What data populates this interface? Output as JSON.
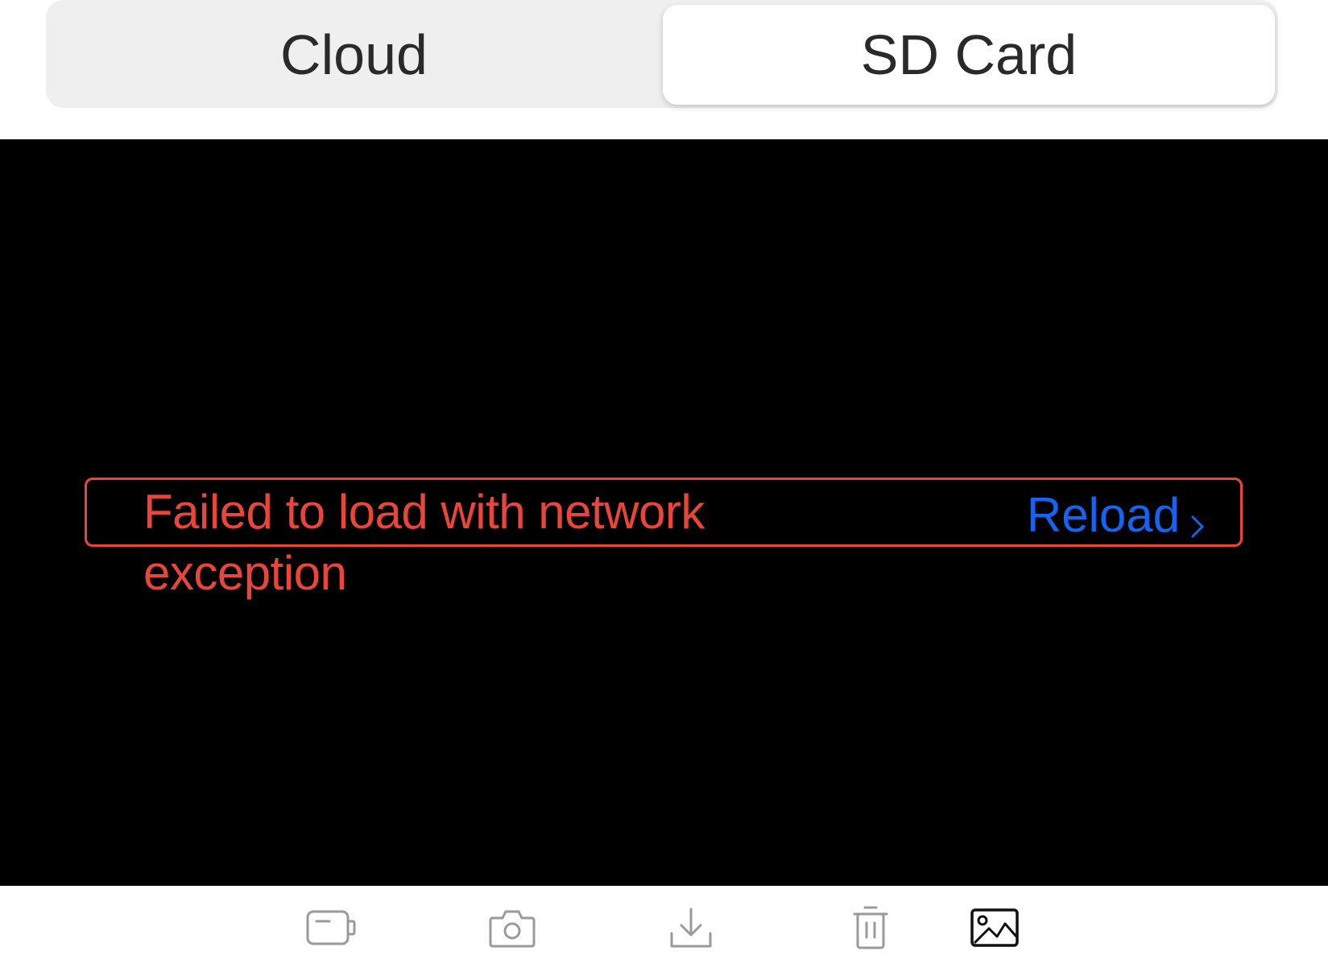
{
  "tabs": {
    "cloud_label": "Cloud",
    "sdcard_label": "SD Card",
    "selected": "SD Card"
  },
  "player": {
    "error_message": "Failed to load with network exception",
    "reload_label": "Reload"
  },
  "toolbar": {
    "icons": [
      "record-video-icon",
      "camera-icon",
      "download-icon",
      "delete-icon",
      "gallery-icon"
    ]
  },
  "colors": {
    "error": "#e8453c",
    "link": "#1463f3",
    "icon_inactive": "#9a9a9a",
    "icon_active": "#111111"
  }
}
